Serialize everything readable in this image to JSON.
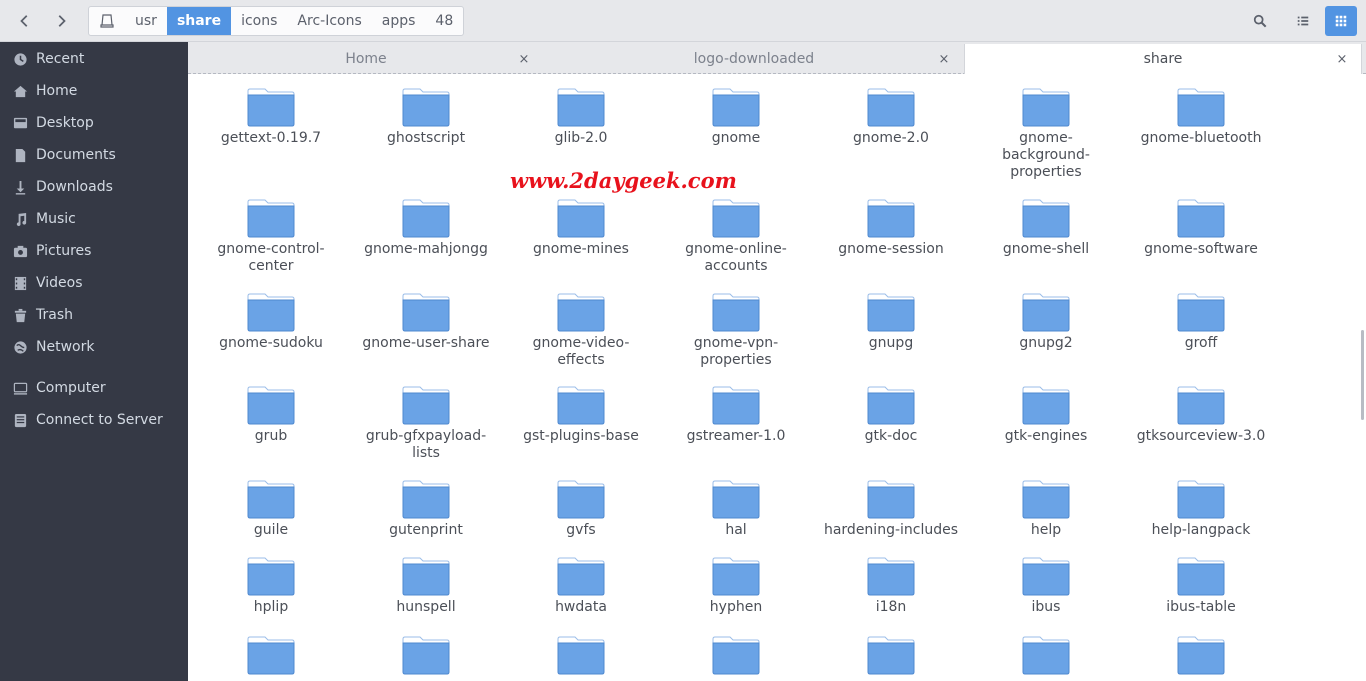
{
  "header": {
    "breadcrumb": [
      "usr",
      "share",
      "icons",
      "Arc-Icons",
      "apps",
      "48"
    ],
    "active_crumb": "share",
    "icons": {
      "back": "chevron-left-icon",
      "forward": "chevron-right-icon",
      "drive": "drive-icon",
      "search": "search-icon",
      "list_view": "list-view-icon",
      "grid_view": "grid-view-icon"
    },
    "grid_view_active": true
  },
  "sidebar": {
    "items": [
      {
        "label": "Recent",
        "icon": "recent-icon"
      },
      {
        "label": "Home",
        "icon": "home-icon"
      },
      {
        "label": "Desktop",
        "icon": "desktop-icon"
      },
      {
        "label": "Documents",
        "icon": "documents-icon"
      },
      {
        "label": "Downloads",
        "icon": "downloads-icon"
      },
      {
        "label": "Music",
        "icon": "music-icon"
      },
      {
        "label": "Pictures",
        "icon": "pictures-icon"
      },
      {
        "label": "Videos",
        "icon": "videos-icon"
      },
      {
        "label": "Trash",
        "icon": "trash-icon"
      },
      {
        "label": "Network",
        "icon": "network-icon"
      },
      {
        "label": "Computer",
        "icon": "computer-icon"
      },
      {
        "label": "Connect to Server",
        "icon": "server-icon"
      }
    ]
  },
  "tabs": [
    {
      "label": "Home",
      "active": false,
      "close": "×"
    },
    {
      "label": "logo-downloaded",
      "active": false,
      "close": "×"
    },
    {
      "label": "share",
      "active": true,
      "close": "×"
    }
  ],
  "files": [
    [
      "gettext-0.19.7",
      "ghostscript",
      "glib-2.0",
      "gnome",
      "gnome-2.0",
      "gnome-\nbackground-\nproperties",
      "gnome-bluetooth"
    ],
    [
      "gnome-control-\ncenter",
      "gnome-mahjongg",
      "gnome-mines",
      "gnome-online-\naccounts",
      "gnome-session",
      "gnome-shell",
      "gnome-software"
    ],
    [
      "gnome-sudoku",
      "gnome-user-share",
      "gnome-video-\neffects",
      "gnome-vpn-\nproperties",
      "gnupg",
      "gnupg2",
      "groff"
    ],
    [
      "grub",
      "grub-gfxpayload-\nlists",
      "gst-plugins-base",
      "gstreamer-1.0",
      "gtk-doc",
      "gtk-engines",
      "gtksourceview-3.0"
    ],
    [
      "guile",
      "gutenprint",
      "gvfs",
      "hal",
      "hardening-includes",
      "help",
      "help-langpack"
    ],
    [
      "hplip",
      "hunspell",
      "hwdata",
      "hyphen",
      "i18n",
      "ibus",
      "ibus-table"
    ],
    [
      "",
      "",
      "",
      "",
      "",
      "",
      ""
    ]
  ],
  "watermark": "www.2daygeek.com",
  "colors": {
    "accent": "#5294e2",
    "sidebar_bg": "#353945",
    "folder": "#6aa3e6",
    "watermark": "#e8121c"
  }
}
